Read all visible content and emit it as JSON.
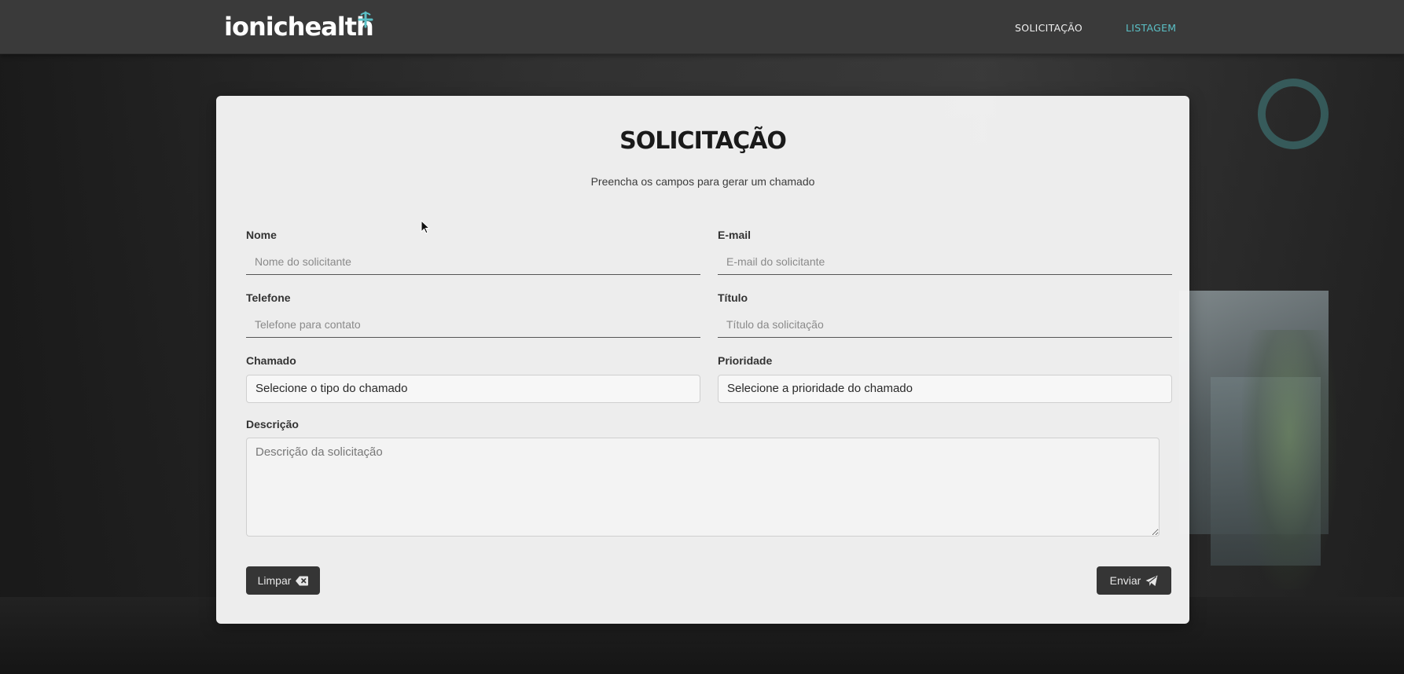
{
  "navbar": {
    "logo_text": "ionichealth",
    "links": [
      {
        "label": "SOLICITAÇÃO"
      },
      {
        "label": "LISTAGEM"
      }
    ]
  },
  "form": {
    "title": "SOLICITAÇÃO",
    "subtitle": "Preencha os campos para gerar um chamado",
    "fields": {
      "nome": {
        "label": "Nome",
        "placeholder": "Nome do solicitante",
        "value": ""
      },
      "email": {
        "label": "E-mail",
        "placeholder": "E-mail do solicitante",
        "value": ""
      },
      "telefone": {
        "label": "Telefone",
        "placeholder": "Telefone para contato",
        "value": ""
      },
      "titulo": {
        "label": "Título",
        "placeholder": "Título da solicitação",
        "value": ""
      },
      "chamado": {
        "label": "Chamado",
        "selected": "Selecione o tipo do chamado"
      },
      "prioridade": {
        "label": "Prioridade",
        "selected": "Selecione a prioridade do chamado"
      },
      "descricao": {
        "label": "Descrição",
        "placeholder": "Descrição da solicitação",
        "value": ""
      }
    },
    "buttons": {
      "limpar": {
        "label": "Limpar",
        "icon": "backspace-icon"
      },
      "enviar": {
        "label": "Enviar",
        "icon": "send-icon"
      }
    }
  },
  "colors": {
    "accent": "#5bc0c6",
    "navbar": "#3a3a3a",
    "button": "#353535"
  }
}
